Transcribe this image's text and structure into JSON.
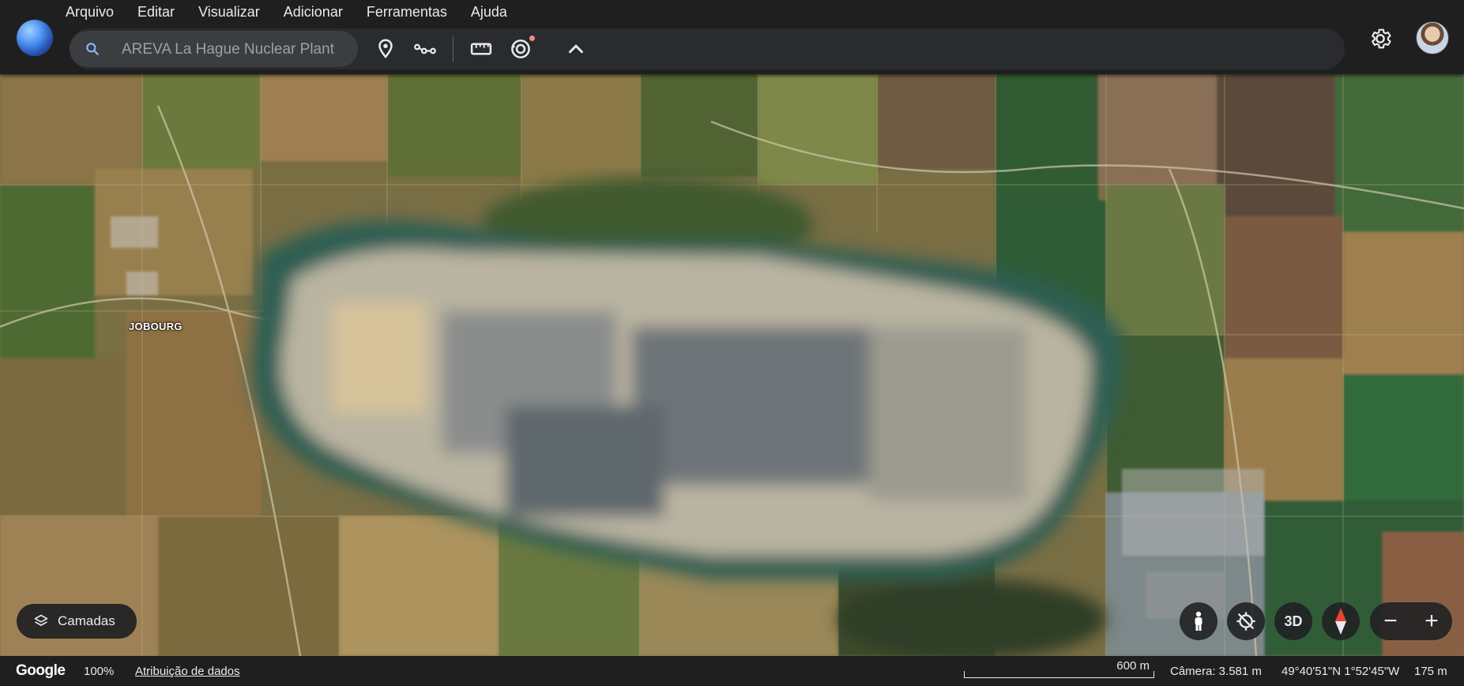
{
  "menu": [
    "Arquivo",
    "Editar",
    "Visualizar",
    "Adicionar",
    "Ferramentas",
    "Ajuda"
  ],
  "search": {
    "placeholder": "AREVA La Hague Nuclear Plant"
  },
  "toolbar": {
    "icons": [
      "place-pin-icon",
      "path-icon",
      "ruler-icon",
      "voyager-icon",
      "chevron-up-icon"
    ],
    "has_notification_dot": true
  },
  "header_right": {
    "settings_icon": "gear-icon",
    "avatar": "user-avatar"
  },
  "map": {
    "place_label": "JOBOURG",
    "layers_button": "Camadas",
    "controls": {
      "view3d": "3D",
      "zoom_out": "−",
      "zoom_in": "+"
    }
  },
  "statusbar": {
    "google": "Google",
    "zoom": "100%",
    "attribution": "Atribuição de dados",
    "scale": "600 m",
    "camera": "Câmera: 3.581 m",
    "coords": "49°40'51\"N 1°52'45\"W",
    "elevation": "175 m"
  },
  "colors": {
    "accent": "#8ab4f8",
    "bar": "#1f1f1f",
    "pill": "#2a2b2e",
    "search_bg": "#3c3d41",
    "compass_red": "#ea4335"
  }
}
